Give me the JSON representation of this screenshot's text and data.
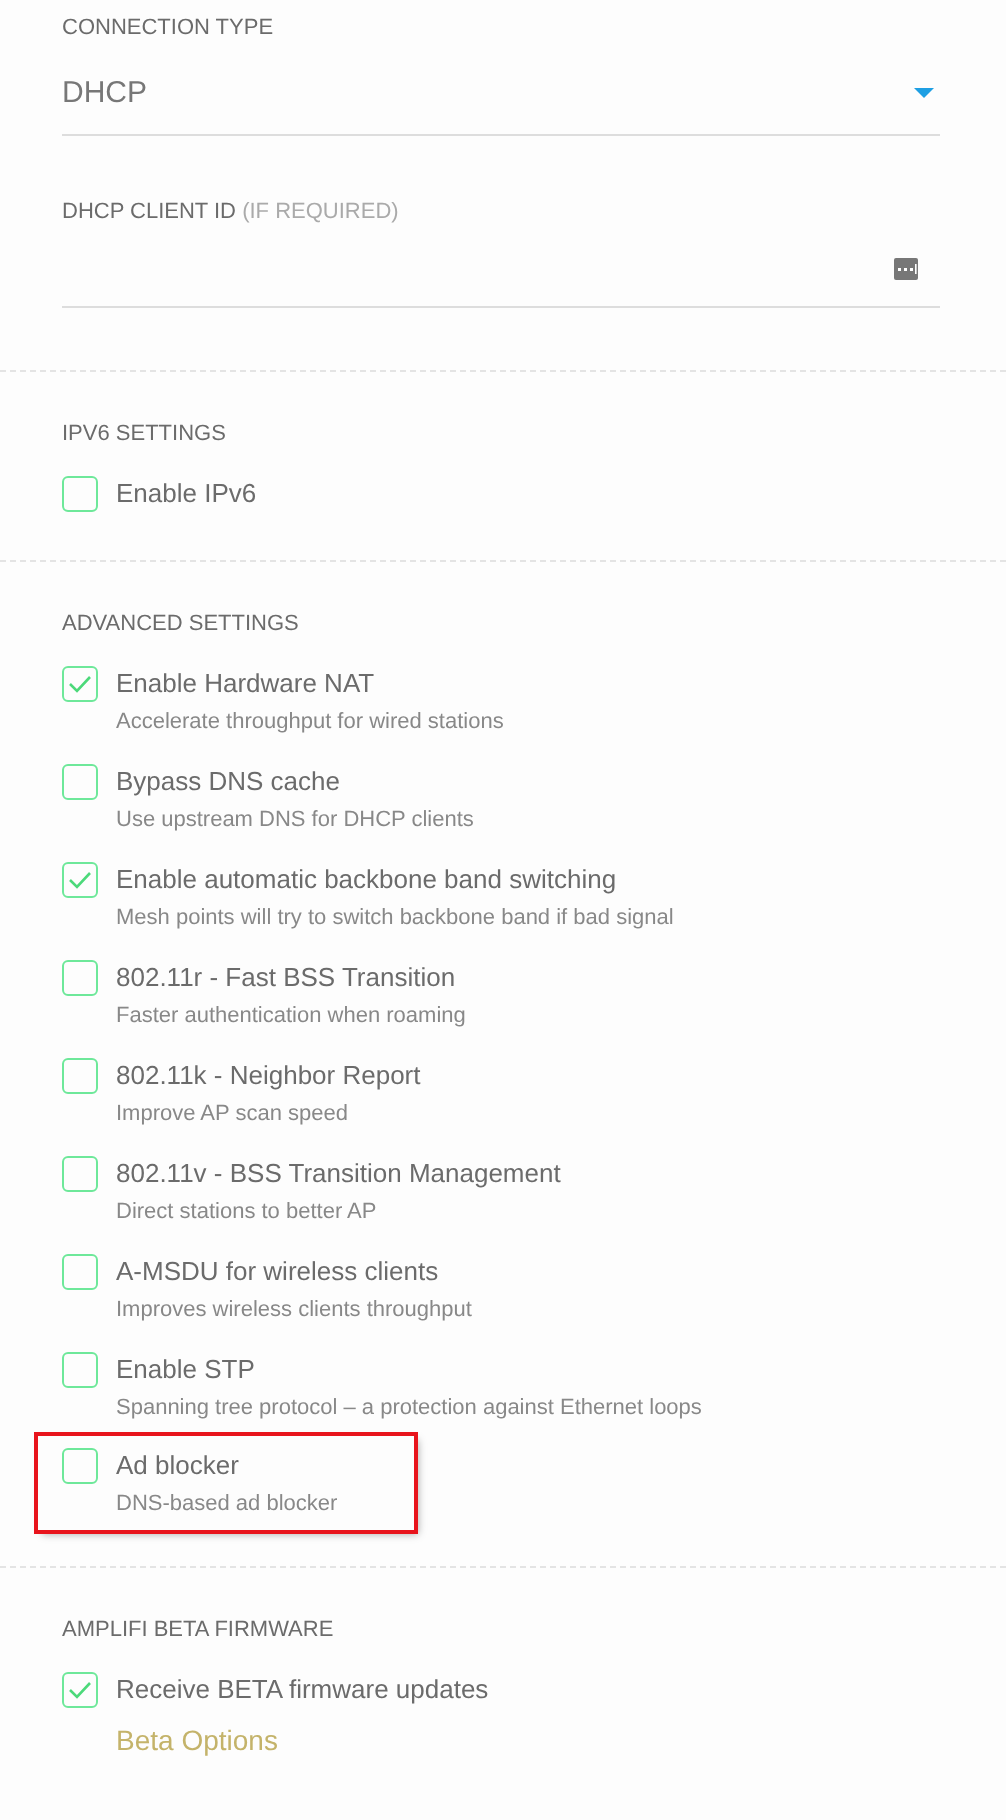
{
  "connection": {
    "label": "CONNECTION TYPE",
    "value": "DHCP"
  },
  "client_id": {
    "label": "DHCP CLIENT ID",
    "note": "(IF REQUIRED)"
  },
  "sections": [
    {
      "title": "IPV6 SETTINGS",
      "items": [
        {
          "label": "Enable IPv6",
          "checked": false,
          "highlighted": false
        }
      ]
    },
    {
      "title": "ADVANCED SETTINGS",
      "items": [
        {
          "label": "Enable Hardware NAT",
          "description": "Accelerate throughput for wired stations",
          "checked": true,
          "highlighted": false
        },
        {
          "label": "Bypass DNS cache",
          "description": "Use upstream DNS for DHCP clients",
          "checked": false,
          "highlighted": false
        },
        {
          "label": "Enable automatic backbone band switching",
          "description": "Mesh points will try to switch backbone band if bad signal",
          "checked": true,
          "highlighted": false
        },
        {
          "label": "802.11r - Fast BSS Transition",
          "description": "Faster authentication when roaming",
          "checked": false,
          "highlighted": false
        },
        {
          "label": "802.11k - Neighbor Report",
          "description": "Improve AP scan speed",
          "checked": false,
          "highlighted": false
        },
        {
          "label": "802.11v - BSS Transition Management",
          "description": "Direct stations to better AP",
          "checked": false,
          "highlighted": false
        },
        {
          "label": "A-MSDU for wireless clients",
          "description": "Improves wireless clients throughput",
          "checked": false,
          "highlighted": false
        },
        {
          "label": "Enable STP",
          "description": "Spanning tree protocol – a protection against Ethernet loops",
          "checked": false,
          "highlighted": false
        },
        {
          "label": "Ad blocker",
          "description": "DNS-based ad blocker",
          "checked": false,
          "highlighted": true
        }
      ]
    },
    {
      "title": "AMPLIFI BETA FIRMWARE",
      "items": [
        {
          "label": "Receive BETA firmware updates",
          "checked": true,
          "highlighted": false
        }
      ],
      "link": "Beta Options"
    }
  ]
}
